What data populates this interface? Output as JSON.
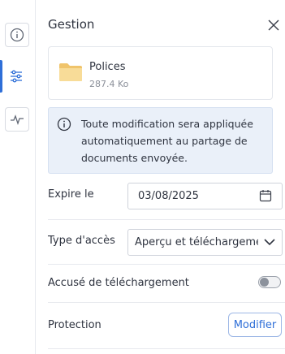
{
  "rail": {
    "items": [
      {
        "icon": "info-icon"
      },
      {
        "icon": "sliders-icon",
        "active": true
      },
      {
        "icon": "activity-icon"
      }
    ],
    "accent": "#2f6fd8"
  },
  "panel": {
    "title": "Gestion",
    "file": {
      "name": "Polices",
      "size": "287.4 Ko",
      "icon": "folder-icon",
      "icon_color": "#f5d38a"
    },
    "info": {
      "text": "Toute modification sera appliquée automatiquement au partage de documents envoyée."
    },
    "expire": {
      "label": "Expire le",
      "value": "03/08/2025"
    },
    "access": {
      "label": "Type d'accès",
      "value": "Aperçu et téléchargement"
    },
    "receipt": {
      "label": "Accusé de téléchargement",
      "enabled": false
    },
    "protection": {
      "label": "Protection",
      "button": "Modifier"
    }
  }
}
